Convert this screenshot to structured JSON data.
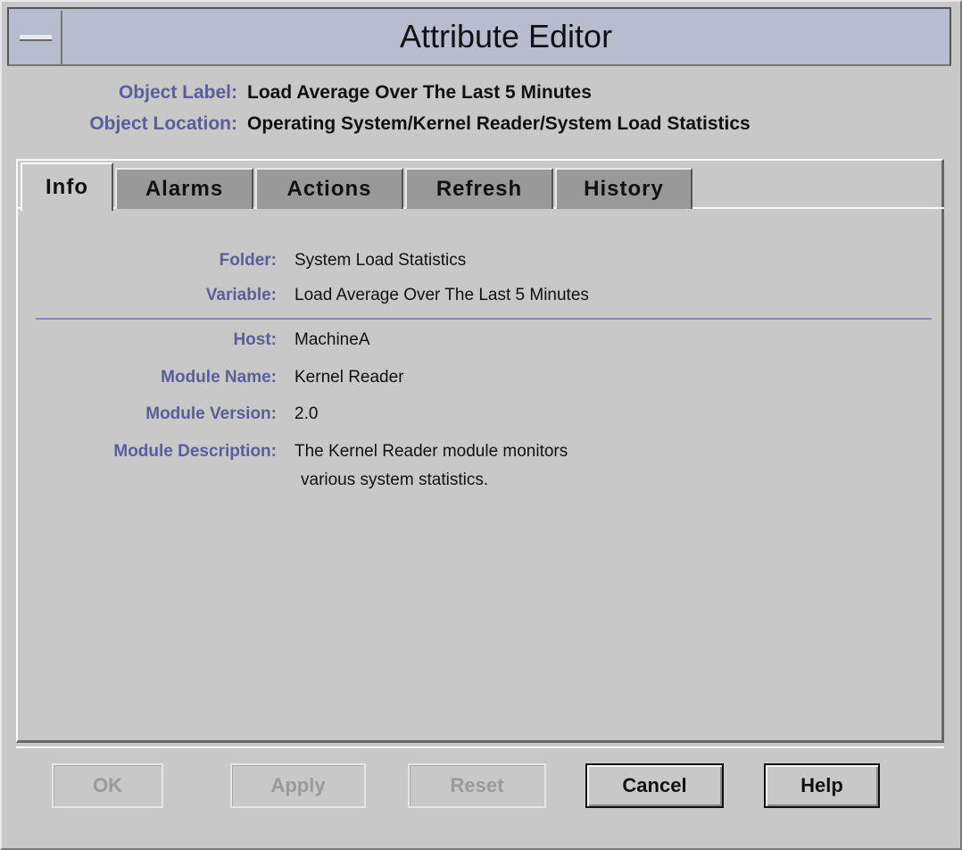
{
  "window": {
    "title": "Attribute Editor"
  },
  "header": {
    "object_label_label": "Object Label:",
    "object_label_value": "Load Average Over The Last 5 Minutes",
    "object_location_label": "Object Location:",
    "object_location_value": "Operating System/Kernel Reader/System Load Statistics"
  },
  "tabs": [
    {
      "label": "Info",
      "active": true
    },
    {
      "label": "Alarms",
      "active": false
    },
    {
      "label": "Actions",
      "active": false
    },
    {
      "label": "Refresh",
      "active": false
    },
    {
      "label": "History",
      "active": false
    }
  ],
  "info": {
    "folder_label": "Folder:",
    "folder_value": "System Load Statistics",
    "variable_label": "Variable:",
    "variable_value": "Load Average Over The Last 5 Minutes",
    "host_label": "Host:",
    "host_value": "MachineA",
    "module_name_label": "Module Name:",
    "module_name_value": "Kernel Reader",
    "module_version_label": "Module Version:",
    "module_version_value": "2.0",
    "module_description_label": "Module Description:",
    "module_description_line1": "The Kernel Reader module monitors",
    "module_description_line2": "various system statistics."
  },
  "buttons": {
    "ok": "OK",
    "apply": "Apply",
    "reset": "Reset",
    "cancel": "Cancel",
    "help": "Help"
  },
  "colors": {
    "label": "#5a5e9a",
    "titlebar": "#b7bccf",
    "background": "#c8c8c8"
  }
}
